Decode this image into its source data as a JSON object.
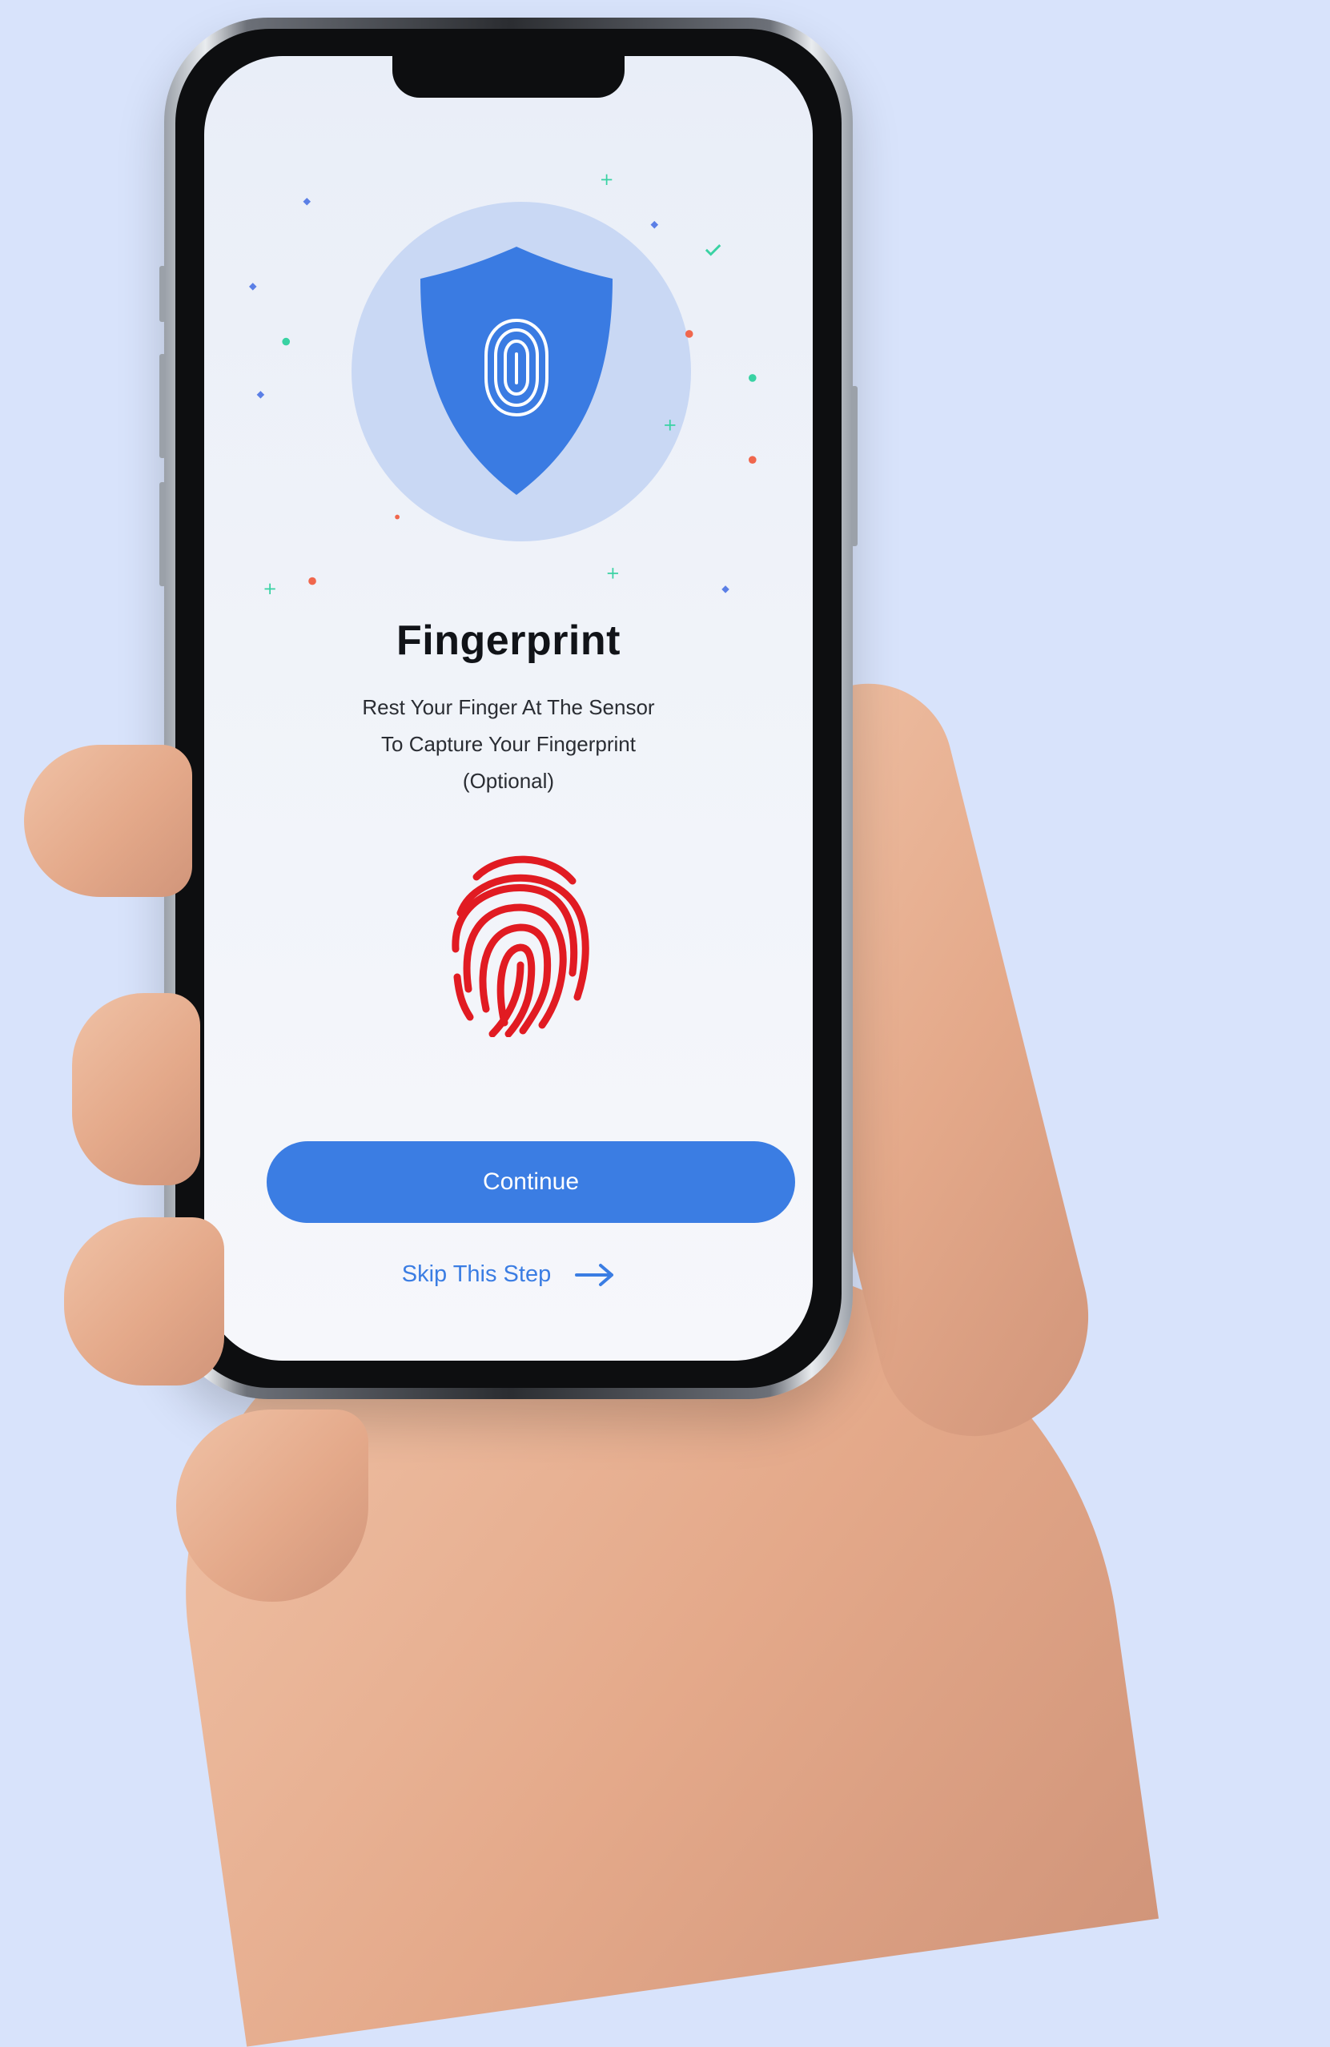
{
  "screen": {
    "title": "Fingerprint",
    "instruction_lines": [
      "Rest Your Finger At The Sensor",
      "To Capture Your Fingerprint",
      "(Optional)"
    ],
    "continue_label": "Continue",
    "skip_label": "Skip This Step"
  },
  "icons": {
    "shield": "shield-fingerprint-icon",
    "fingerprint": "fingerprint-icon",
    "skip_arrow": "arrow-right-icon"
  },
  "colors": {
    "background": "#d8e3fb",
    "accent": "#3b7de3",
    "fingerprint": "#e11b22",
    "shield": "#3a7be2",
    "circle": "#c9d8f4"
  }
}
